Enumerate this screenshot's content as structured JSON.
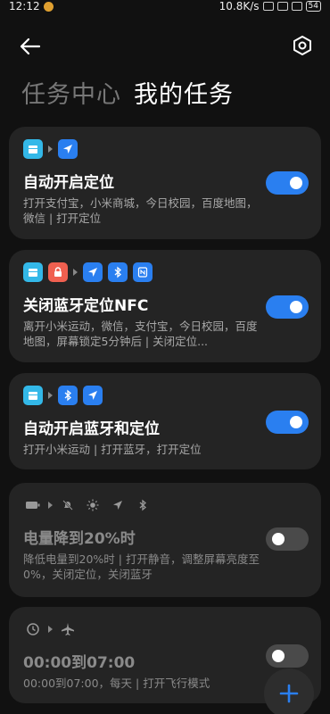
{
  "status_bar": {
    "time": "12:12",
    "net_speed": "10.8K/s",
    "battery": "54"
  },
  "header": {
    "back_icon": "back-arrow-icon",
    "settings_icon": "settings-hexagon-icon"
  },
  "tabs": [
    {
      "label": "任务中心",
      "active": false
    },
    {
      "label": "我的任务",
      "active": true
    }
  ],
  "tasks": [
    {
      "title": "自动开启定位",
      "description": "打开支付宝，小米商城，今日校园，百度地图，微信 | 打开定位",
      "enabled": true,
      "icons": [
        "app-icon",
        "location-icon"
      ]
    },
    {
      "title": "关闭蓝牙定位NFC",
      "description": "离开小米运动，微信，支付宝，今日校园，百度地图，屏幕锁定5分钟后 | 关闭定位...",
      "enabled": true,
      "icons": [
        "app-icon",
        "lock-icon",
        "location-icon",
        "bluetooth-icon",
        "nfc-icon"
      ]
    },
    {
      "title": "自动开启蓝牙和定位",
      "description": "打开小米运动 | 打开蓝牙，打开定位",
      "enabled": true,
      "icons": [
        "app-icon",
        "bluetooth-icon",
        "location-icon"
      ]
    },
    {
      "title": "电量降到20%时",
      "description": "降低电量到20%时 | 打开静音，调整屏幕亮度至0%，关闭定位，关闭蓝牙",
      "enabled": false,
      "icons": [
        "battery-icon",
        "mute-icon",
        "brightness-icon",
        "location-icon",
        "bluetooth-icon"
      ]
    },
    {
      "title": "00:00到07:00",
      "description": "00:00到07:00，每天 | 打开飞行模式",
      "enabled": false,
      "icons": [
        "clock-icon",
        "airplane-icon"
      ]
    }
  ],
  "fab": {
    "icon": "plus-icon"
  },
  "colors": {
    "accent": "#2a7ff0",
    "card": "#242424",
    "background": "#111111"
  }
}
